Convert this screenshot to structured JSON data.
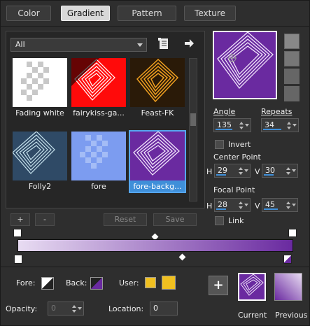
{
  "tabs": [
    "Color",
    "Gradient",
    "Pattern",
    "Texture"
  ],
  "library": {
    "category": "All"
  },
  "thumbnails": [
    {
      "label": "Fading white"
    },
    {
      "label": "fairykiss-ga..."
    },
    {
      "label": "Feast-FK"
    },
    {
      "label": "Folly2"
    },
    {
      "label": "fore"
    },
    {
      "label": "fore-backg..."
    }
  ],
  "buttons": {
    "add": "+",
    "remove": "-",
    "reset": "Reset",
    "save": "Save"
  },
  "angle": {
    "label": "Angle",
    "value": "135"
  },
  "repeats": {
    "label": "Repeats",
    "value": "34"
  },
  "invert": {
    "label": "Invert"
  },
  "center": {
    "label": "Center Point",
    "h_label": "H",
    "h": "29",
    "v_label": "V",
    "v": "30"
  },
  "focal": {
    "label": "Focal Point",
    "h_label": "H",
    "h": "28",
    "v_label": "V",
    "v": "45"
  },
  "link": {
    "label": "Link"
  },
  "bottom": {
    "fore": "Fore:",
    "back": "Back:",
    "user": "User:",
    "opacity": "Opacity:",
    "opacity_value": "0",
    "location": "Location:",
    "location_value": "0",
    "current": "Current",
    "previous": "Previous"
  },
  "colors": {
    "purple": "#6a2aa0",
    "lavender": "#e8dcf2",
    "yellow": "#f0c020"
  }
}
